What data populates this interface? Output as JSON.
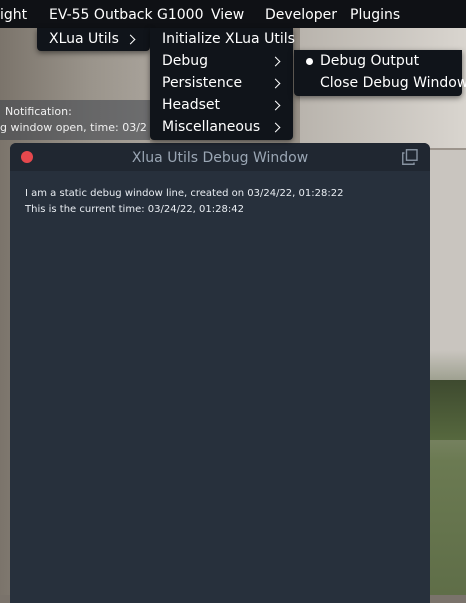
{
  "menubar": {
    "items": [
      "ight",
      "EV-55 Outback G1000",
      "View",
      "Developer",
      "Plugins"
    ]
  },
  "plugin_menu": {
    "item": "XLua Utils"
  },
  "xlua_menu": {
    "items": [
      "Initialize XLua Utils",
      "Debug",
      "Persistence",
      "Headset",
      "Miscellaneous"
    ]
  },
  "debug_menu": {
    "items": [
      "Debug Output",
      "Close Debug Window"
    ],
    "checked": "Debug Output"
  },
  "notification": {
    "line1": "Notification:",
    "line2": "g window open, time: 03/2"
  },
  "debug_window": {
    "title": "Xlua Utils Debug Window",
    "lines": [
      "I am a static debug window line, created on 03/24/22, 01:28:22",
      "This is the current time: 03/24/22, 01:28:42"
    ]
  },
  "colors": {
    "menu_bg": "#10141a",
    "window_bg": "#27303c",
    "titlebar_bg": "#202731",
    "close_button": "#e5484d"
  },
  "icons": {
    "close": "close-dot-icon",
    "popout": "popout-window-icon",
    "submenu": "chevron-right-icon",
    "checked": "bullet-icon"
  }
}
